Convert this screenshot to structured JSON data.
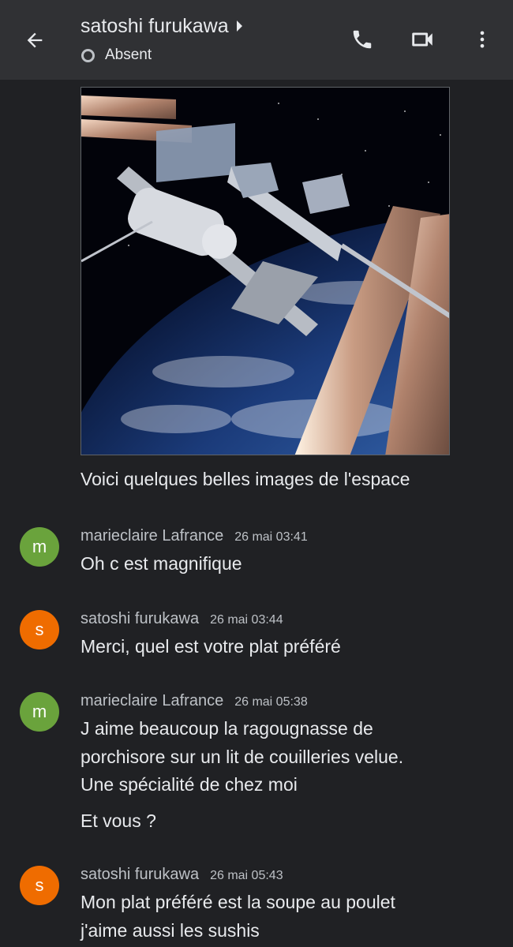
{
  "header": {
    "title": "satoshi furukawa",
    "status": "Absent"
  },
  "image_post": {
    "caption": "Voici quelques belles images de l'espace"
  },
  "messages": [
    {
      "author": "marieclaire Lafrance",
      "initial": "m",
      "avatar_color": "#6aa33c",
      "time": "26 mai 03:41",
      "lines": [
        "Oh c est magnifique"
      ]
    },
    {
      "author": "satoshi furukawa",
      "initial": "s",
      "avatar_color": "#ef6c00",
      "time": "26 mai 03:44",
      "lines": [
        "Merci, quel est votre plat préféré"
      ]
    },
    {
      "author": "marieclaire Lafrance",
      "initial": "m",
      "avatar_color": "#6aa33c",
      "time": "26 mai 05:38",
      "lines": [
        "J aime beaucoup la ragougnasse de",
        "porchisore sur un lit de couilleries velue.",
        "Une spécialité de chez moi",
        "Et vous ?"
      ]
    },
    {
      "author": "satoshi furukawa",
      "initial": "s",
      "avatar_color": "#ef6c00",
      "time": "26 mai 05:43",
      "lines": [
        "Mon plat préféré est la soupe au poulet",
        "j'aime aussi les sushis"
      ]
    }
  ],
  "icons": {
    "back": "arrow-back-icon",
    "call": "phone-icon",
    "video": "videocam-icon",
    "more": "more-vert-icon"
  }
}
